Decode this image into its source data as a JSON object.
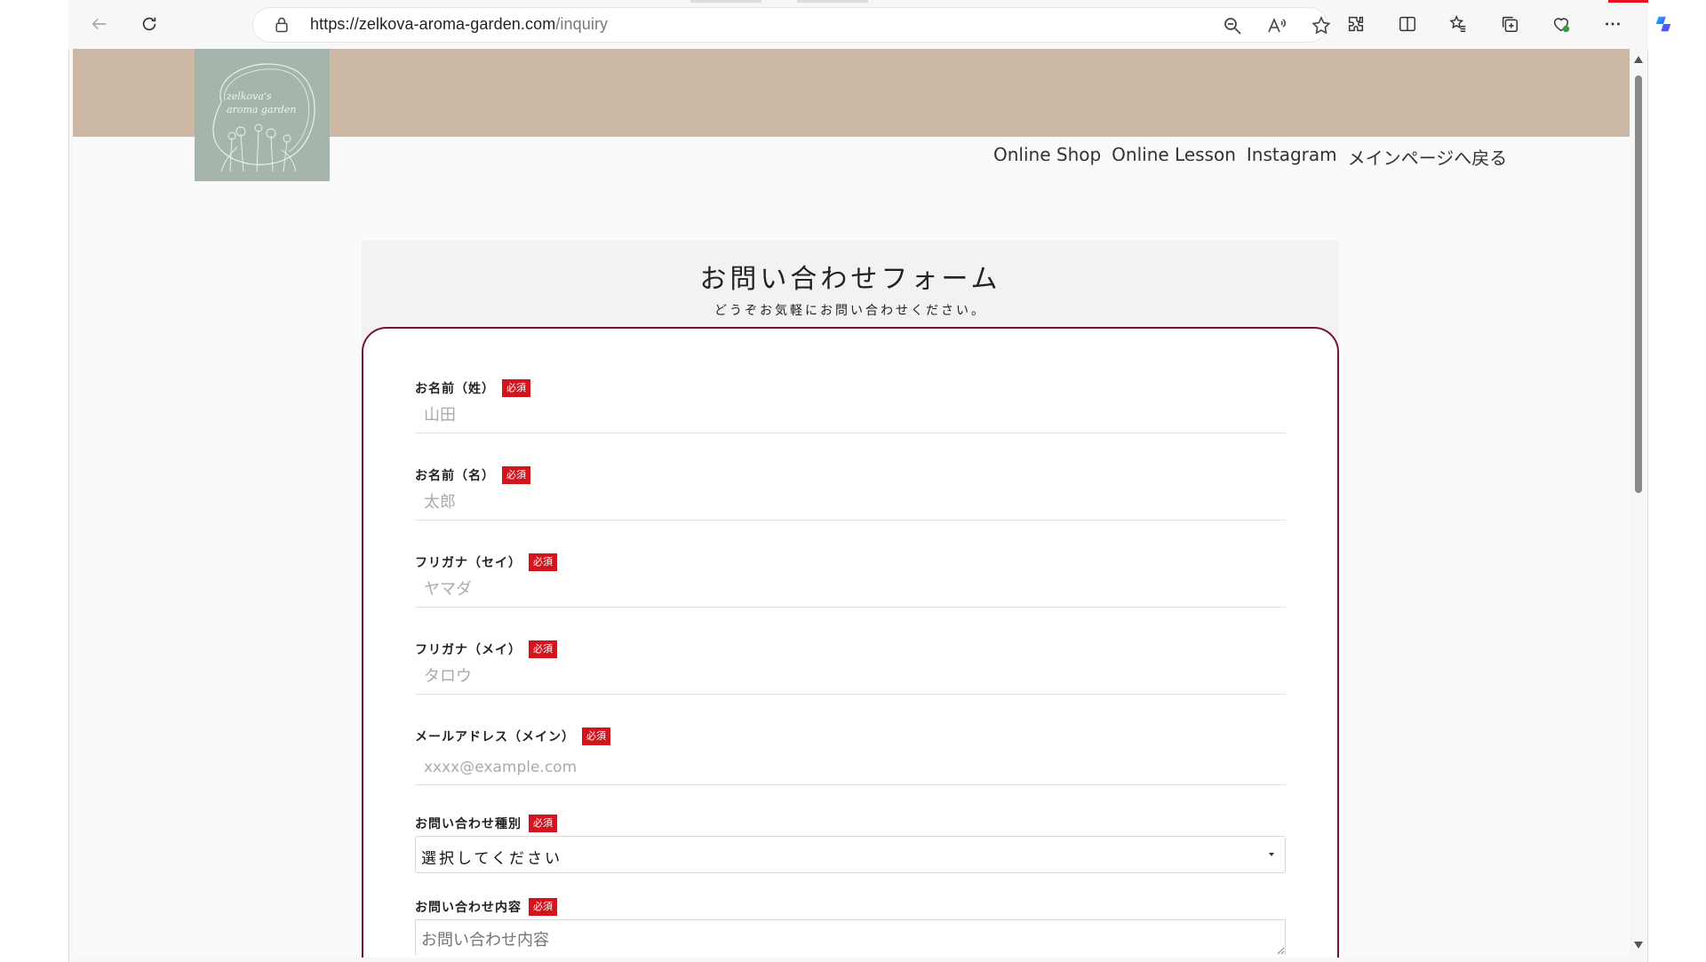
{
  "browser": {
    "url_host": "https://zelkova-aroma-garden.com",
    "url_path": "/inquiry",
    "icons": [
      "back-icon",
      "refresh-icon",
      "lock-icon",
      "zoom-out-icon",
      "read-aloud-icon",
      "favorite-star-icon",
      "extensions-icon",
      "split-screen-icon",
      "favorites-icon",
      "collections-icon",
      "browser-essentials-icon",
      "more-icon",
      "copilot-icon"
    ]
  },
  "site": {
    "logo_text_line1": "zelkova's",
    "logo_text_line2": "aroma garden",
    "nav": [
      "Online Shop",
      "Online Lesson",
      "Instagram",
      "メインページへ戻る"
    ]
  },
  "form": {
    "title": "お問い合わせフォーム",
    "subtitle": "どうぞお気軽にお問い合わせください。",
    "required_badge": "必須",
    "fields": [
      {
        "label": "お名前（姓）",
        "placeholder": "山田"
      },
      {
        "label": "お名前（名）",
        "placeholder": "太郎"
      },
      {
        "label": "フリガナ（セイ）",
        "placeholder": "ヤマダ"
      },
      {
        "label": "フリガナ（メイ）",
        "placeholder": "タロウ"
      },
      {
        "label": "メールアドレス（メイン）",
        "placeholder": "xxxx@example.com"
      }
    ],
    "inquiry_type": {
      "label": "お問い合わせ種別",
      "selected": "選択してください"
    },
    "inquiry_content": {
      "label": "お問い合わせ内容",
      "placeholder": "お問い合わせ内容"
    }
  },
  "colors": {
    "banner": "#cdb8a6",
    "logo_bg": "#a5b5ab",
    "card_border": "#7a1230",
    "required": "#d2141c"
  }
}
